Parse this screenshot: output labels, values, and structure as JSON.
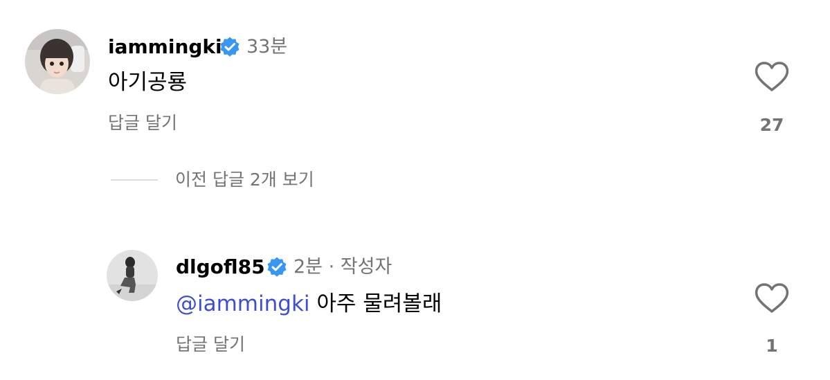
{
  "comments": [
    {
      "username": "iammingki",
      "verified": true,
      "time": "33분",
      "text": "아기공룡",
      "reply_label": "답글 달기",
      "like_count": "27"
    },
    {
      "username": "dlgofl85",
      "verified": true,
      "time": "2분 · 작성자",
      "mention": "@iammingki",
      "text": " 아주 물려볼래",
      "reply_label": "답글 달기",
      "like_count": "1"
    }
  ],
  "view_replies_label": "이전 답글 2개 보기",
  "colors": {
    "verified_badge": "#3897f0",
    "mention": "#3e4ecf",
    "secondary_text": "#737373"
  },
  "icons": [
    "verified-badge-icon",
    "heart-icon"
  ]
}
